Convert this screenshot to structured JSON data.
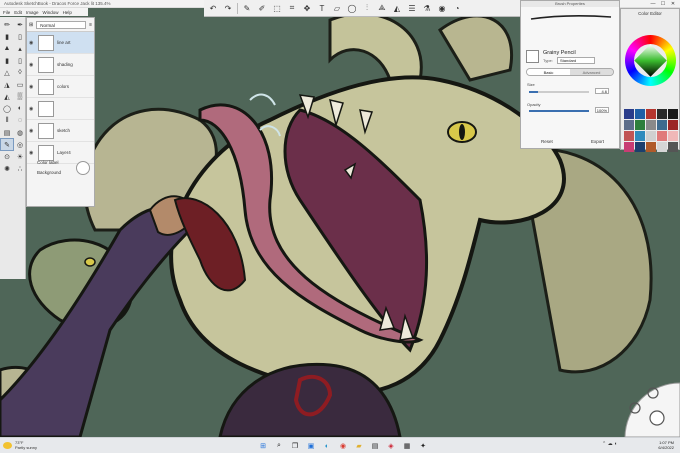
{
  "window": {
    "title": "Autodesk SketchBook - Dracos Force Jack lit 135.4%",
    "controls": [
      "—",
      "☐",
      "✕"
    ]
  },
  "menu": [
    "File",
    "Edit",
    "Image",
    "Window",
    "Help"
  ],
  "toolbar": {
    "icons": [
      "undo-icon",
      "redo-icon",
      "brush-icon",
      "pencil-icon",
      "select-icon",
      "crop-icon",
      "transform-icon",
      "text-icon",
      "ruler-icon",
      "ellipse-icon",
      "symmetry-icon",
      "perspective-icon",
      "fill-icon",
      "layers-icon",
      "brush-library-icon",
      "color-wheel-icon",
      "copic-icon"
    ]
  },
  "layers": {
    "blend_mode": "Normal",
    "items": [
      {
        "name": "line art",
        "active": true
      },
      {
        "name": "shading",
        "active": false
      },
      {
        "name": "colors",
        "active": false
      },
      {
        "name": "",
        "active": false
      },
      {
        "name": "sketch",
        "active": false
      },
      {
        "name": "Layer4",
        "active": false
      }
    ],
    "color_label": "Color label",
    "background_label": "Background"
  },
  "brush_properties": {
    "title": "Brush Properties",
    "brush_name": "Grainy Pencil",
    "type_label": "Type:",
    "type_value": "Standard",
    "tab_basic": "Basic",
    "tab_advanced": "Advanced",
    "size_label": "Size",
    "size_value": "4.6",
    "opacity_label": "Opacity",
    "opacity_value": "100%",
    "opacity_fraction": 1.0,
    "size_fraction": 0.15,
    "reset_label": "Reset",
    "export_label": "Export"
  },
  "color_editor": {
    "title": "Color Editor",
    "swatches": [
      "#2a3c8a",
      "#1f5fa6",
      "#b5362f",
      "#2b2b2b",
      "#1a1a1a",
      "#5c6d8a",
      "#2d7f3b",
      "#8a8a8a",
      "#3e6b8f",
      "#9c2626",
      "#c15454",
      "#2f8bbd",
      "#d0d0d0",
      "#e07a7a",
      "#f0b8b8",
      "#c83d73",
      "#1c3f6e",
      "#b05a2a",
      "#d6d6d6",
      "#555555"
    ]
  },
  "taskbar": {
    "temperature": "73°F",
    "condition": "Partly sunny",
    "time": "1:07 PM",
    "date": "6/4/2022"
  }
}
